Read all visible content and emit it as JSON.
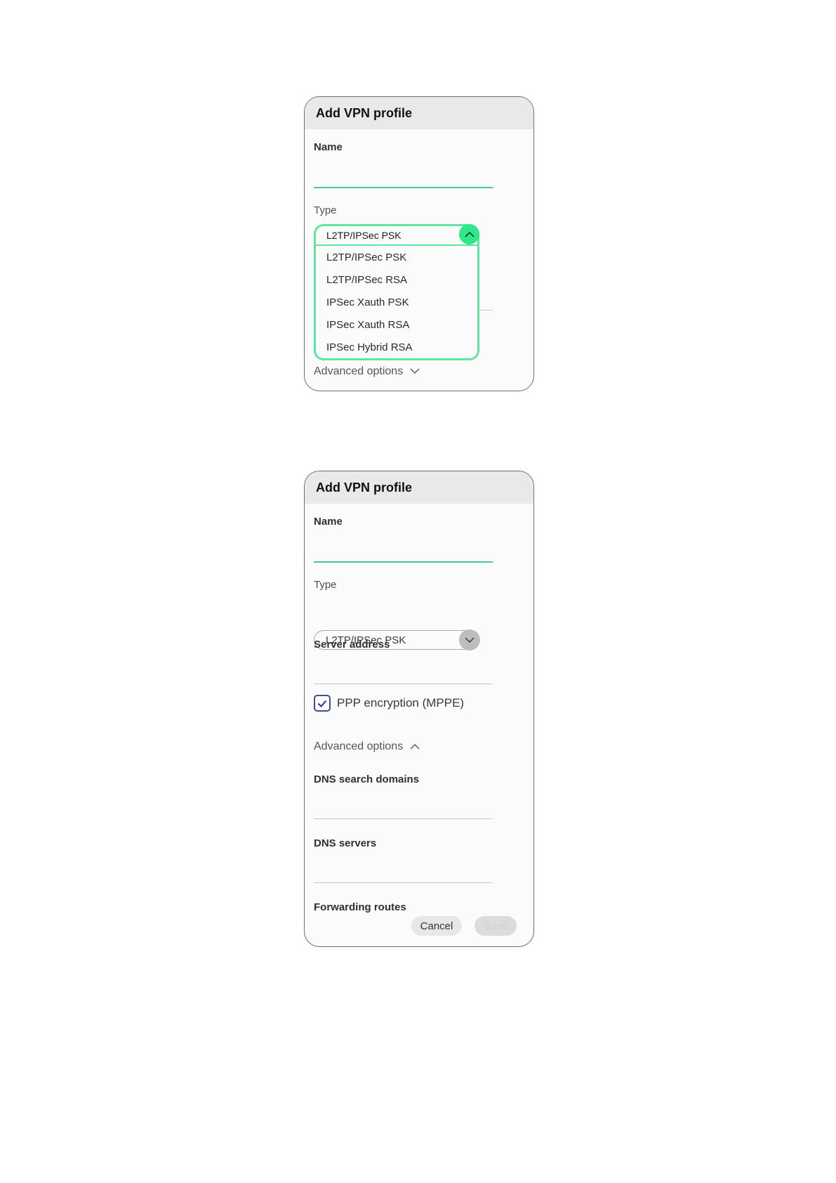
{
  "panel1": {
    "title": "Add VPN profile",
    "name_label": "Name",
    "type_label": "Type",
    "type_selected": "L2TP/IPSec PSK",
    "type_options": [
      "L2TP/IPSec PSK",
      "L2TP/IPSec RSA",
      "IPSec Xauth PSK",
      "IPSec Xauth RSA",
      "IPSec Hybrid RSA"
    ],
    "advanced_options": "Advanced options"
  },
  "panel2": {
    "title": "Add VPN profile",
    "name_label": "Name",
    "type_label": "Type",
    "type_selected": "L2TP/IPSec PSK",
    "server_address_label": "Server address",
    "ppp_encryption_label": "PPP encryption (MPPE)",
    "ppp_encryption_checked": true,
    "advanced_options": "Advanced options",
    "dns_search_domains_label": "DNS search domains",
    "dns_servers_label": "DNS servers",
    "forwarding_routes_label": "Forwarding routes",
    "cancel_label": "Cancel",
    "save_label": "Save"
  },
  "colors": {
    "accent_green": "#2fe88a",
    "check_blue": "#3c4f9a"
  }
}
